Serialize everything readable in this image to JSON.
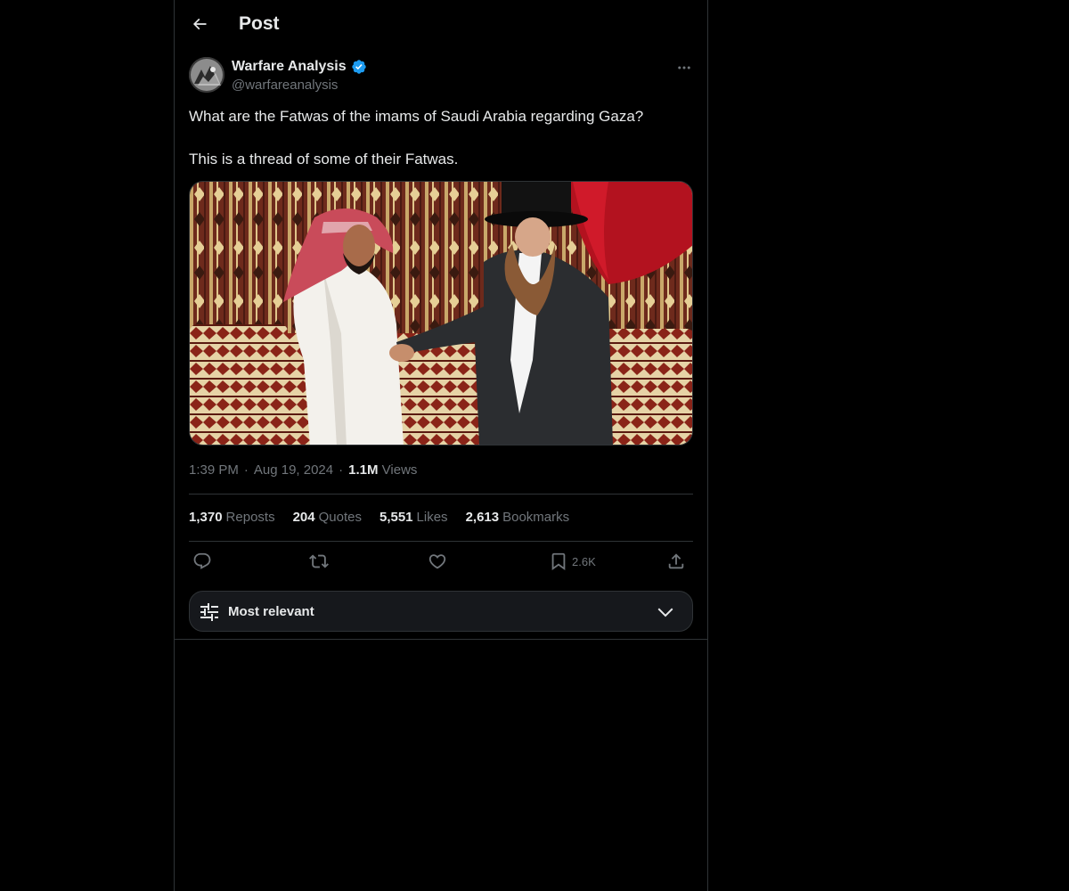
{
  "header": {
    "title": "Post",
    "back_icon": "arrow-left-icon"
  },
  "post": {
    "author": {
      "name": "Warfare Analysis",
      "handle": "@warfareanalysis",
      "verified": true,
      "verified_color": "#1d9bf0"
    },
    "text": [
      "What are the Fatwas of the imams of Saudi Arabia regarding Gaza?",
      "This is a thread of some of their Fatwas."
    ],
    "media": {
      "type": "photo"
    },
    "time": "1:39 PM",
    "date": "Aug 19, 2024",
    "separator": "·",
    "views_count": "1.1M",
    "views_label": "Views",
    "stats": [
      {
        "count": "1,370",
        "label": "Reposts"
      },
      {
        "count": "204",
        "label": "Quotes"
      },
      {
        "count": "5,551",
        "label": "Likes"
      },
      {
        "count": "2,613",
        "label": "Bookmarks"
      }
    ],
    "actions": {
      "reply_icon": "reply-icon",
      "repost_icon": "repost-icon",
      "like_icon": "heart-icon",
      "bookmark_icon": "bookmark-icon",
      "bookmark_count": "2.6K",
      "share_icon": "share-icon"
    }
  },
  "replies_sort": {
    "label": "Most relevant",
    "icon": "sliders-icon",
    "chevron": "chevron-down-icon"
  },
  "colors": {
    "background": "#000000",
    "text_primary": "#e7e9ea",
    "text_secondary": "#71767b",
    "border": "#2f3336",
    "accent": "#1d9bf0"
  }
}
